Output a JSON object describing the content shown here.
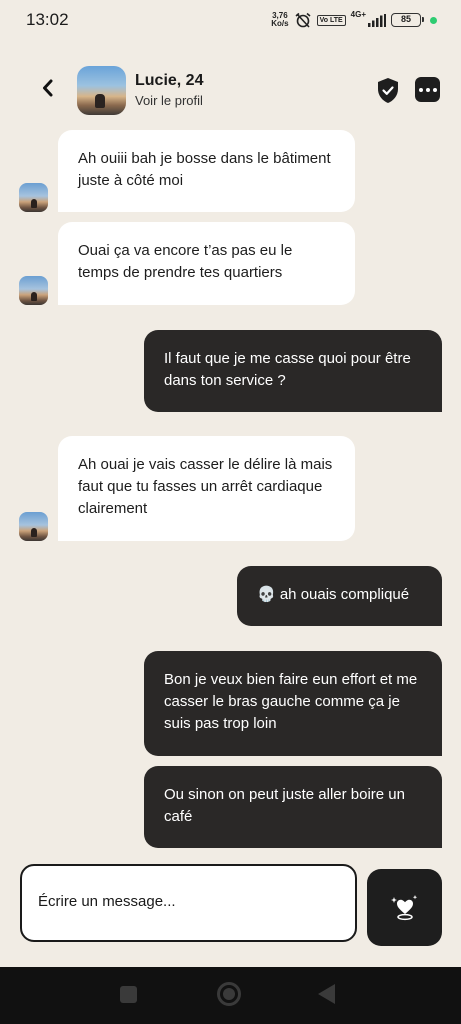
{
  "status_bar": {
    "time": "13:02",
    "net_speed_value": "3,76",
    "net_speed_unit": "Ko/s",
    "lte_label": "Vo LTE",
    "network_label": "4G+",
    "battery": "85"
  },
  "header": {
    "name": "Lucie, 24",
    "profile_link": "Voir le profil"
  },
  "messages": [
    {
      "direction": "in",
      "text": "Ah ouiii bah je bosse dans le bâtiment juste à côté moi"
    },
    {
      "direction": "in",
      "text": "Ouai ça va encore t’as pas eu le temps de prendre tes quartiers"
    },
    {
      "direction": "out",
      "text": "Il faut que je me casse quoi pour être dans ton service ?"
    },
    {
      "direction": "in",
      "text": "Ah ouai je vais casser le délire là mais faut que tu fasses un arrêt cardiaque clairement"
    },
    {
      "direction": "out",
      "text": "💀 ah ouais compliqué"
    },
    {
      "direction": "out",
      "text": "Bon je veux bien faire eun effort et me casser le bras gauche comme ça je suis pas trop loin"
    },
    {
      "direction": "out",
      "text": "Ou sinon on peut juste aller boire un café"
    }
  ],
  "composer": {
    "placeholder": "Écrire un message..."
  },
  "colors": {
    "background": "#f1ece4",
    "incoming_bubble": "#ffffff",
    "outgoing_bubble": "#2a2827",
    "accent_dark": "#1e1e1e"
  },
  "icons": {
    "back": "chevron-left-icon",
    "shield": "shield-check-icon",
    "more": "more-dots-icon",
    "gift": "heart-sparkle-icon"
  }
}
